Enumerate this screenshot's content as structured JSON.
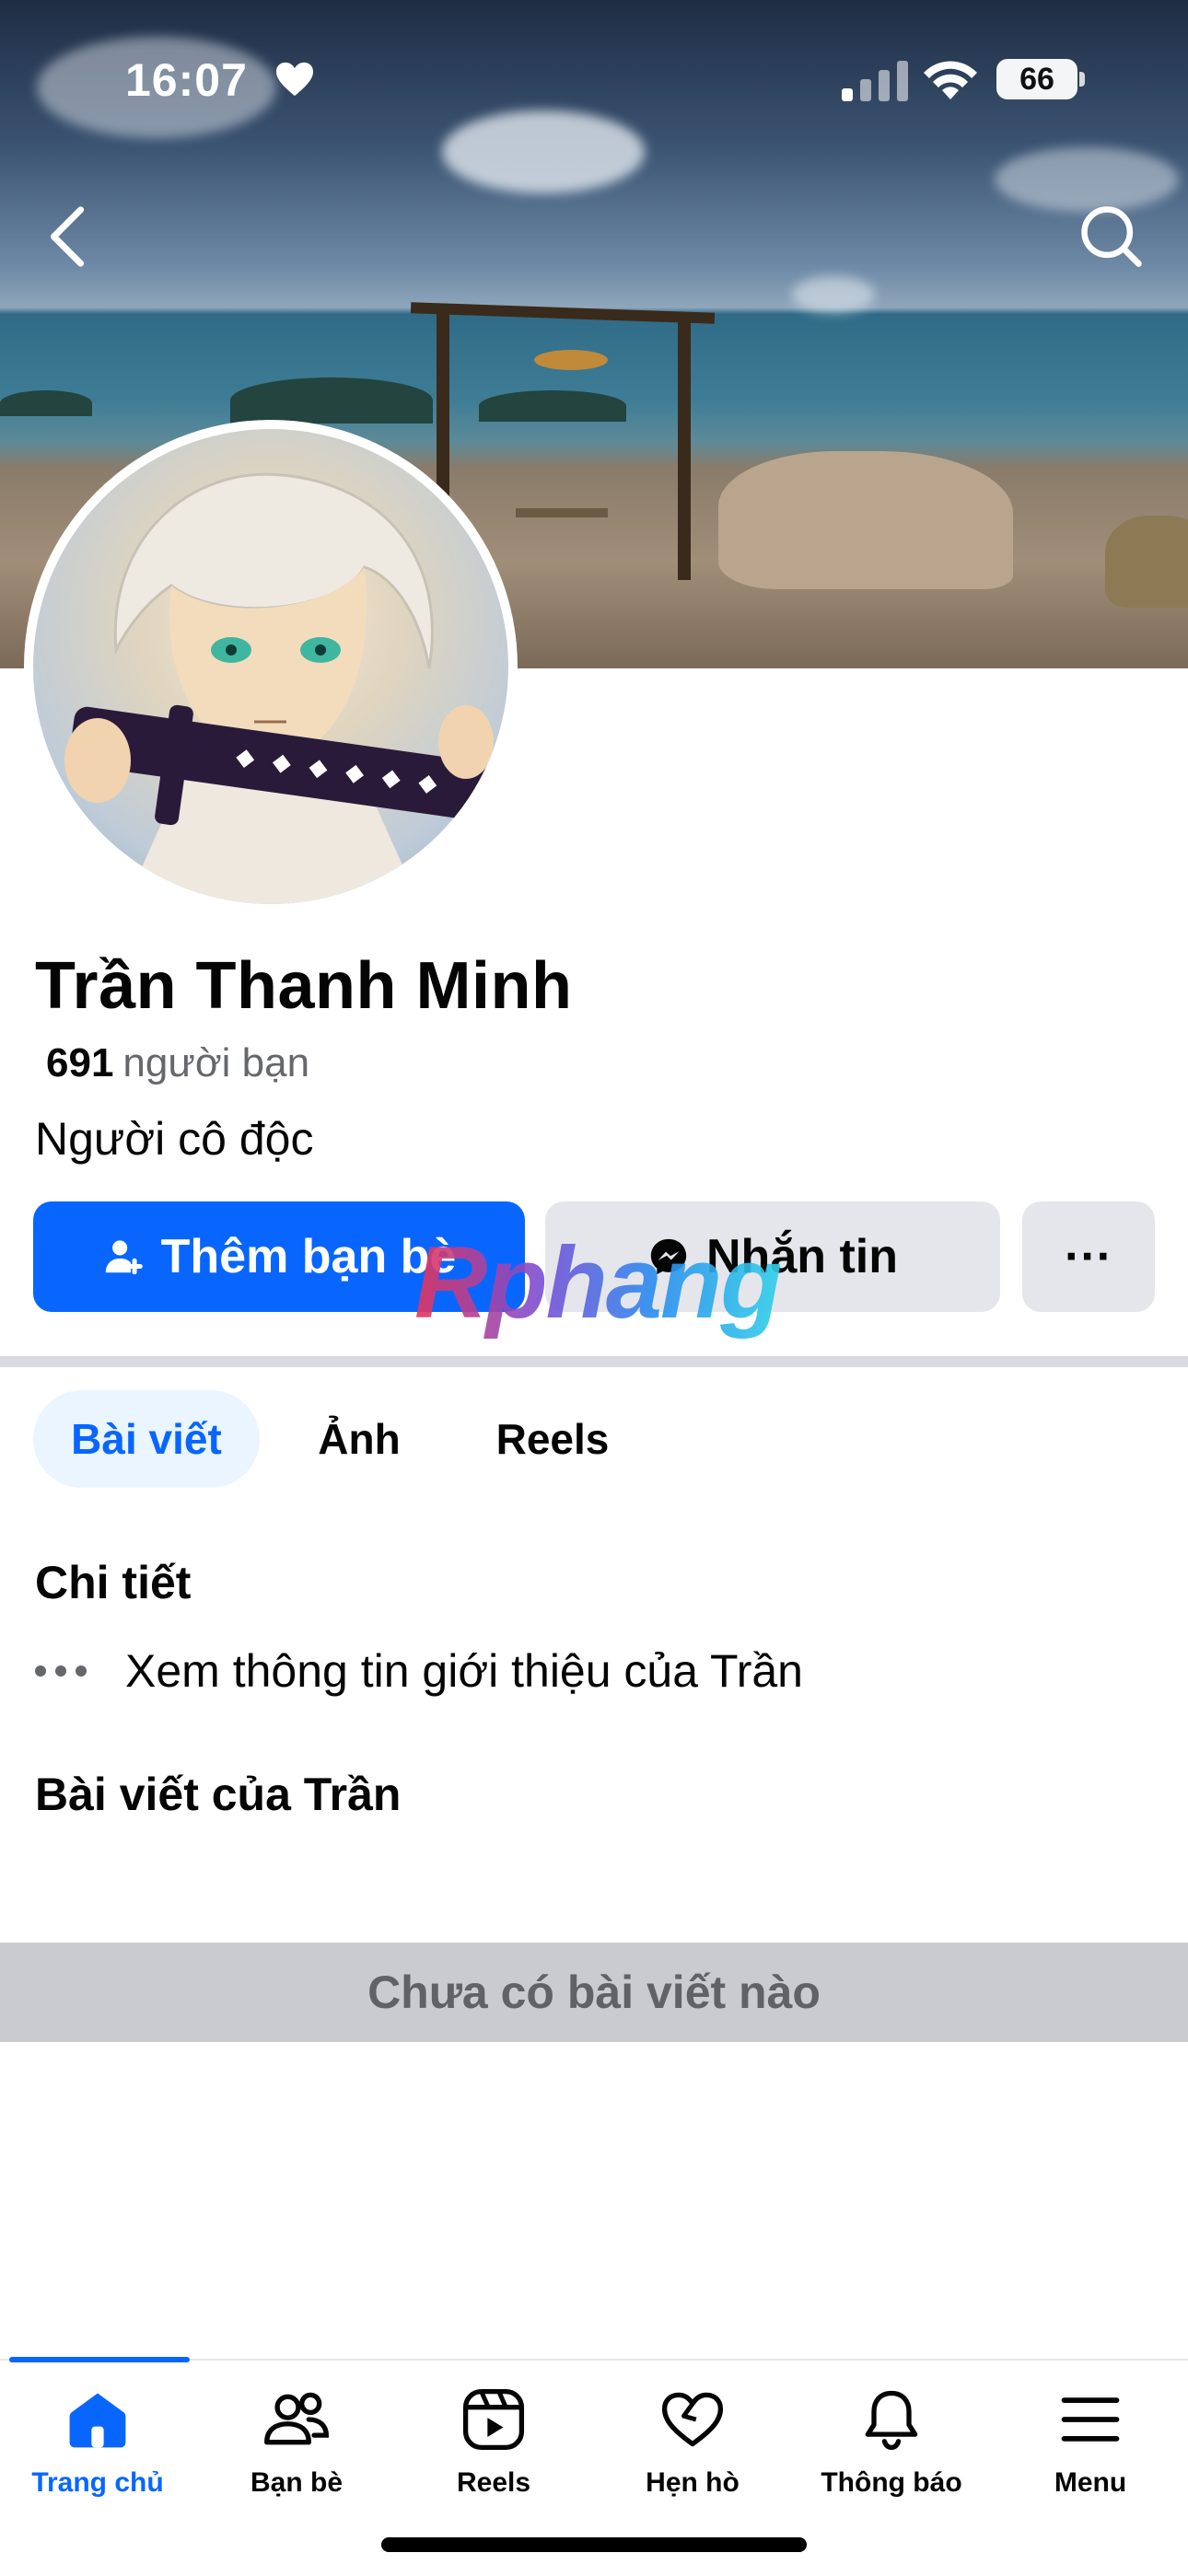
{
  "status_bar": {
    "time": "16:07",
    "battery": "66",
    "icons": [
      "heart-icon",
      "signal-icon",
      "wifi-icon",
      "battery-icon"
    ]
  },
  "header": {
    "icons": [
      "back-chevron-icon",
      "search-icon"
    ]
  },
  "profile": {
    "name": "Trần Thanh Minh",
    "friends_count": "691",
    "friends_label": "người bạn",
    "bio": "Người cô độc"
  },
  "actions": {
    "add_friend": "Thêm bạn bè",
    "message": "Nhắn tin",
    "more": "···"
  },
  "watermark": "Rphang",
  "tabs": [
    {
      "label": "Bài viết",
      "active": true
    },
    {
      "label": "Ảnh",
      "active": false
    },
    {
      "label": "Reels",
      "active": false
    }
  ],
  "details": {
    "title": "Chi tiết",
    "see_intro": "Xem thông tin giới thiệu của Trần"
  },
  "posts": {
    "title": "Bài viết của Trần",
    "empty": "Chưa có bài viết nào"
  },
  "bottom_nav": [
    {
      "label": "Trang chủ",
      "icon": "home-icon",
      "active": true
    },
    {
      "label": "Bạn bè",
      "icon": "friends-icon",
      "active": false
    },
    {
      "label": "Reels",
      "icon": "reels-icon",
      "active": false
    },
    {
      "label": "Hẹn hò",
      "icon": "dating-heart-icon",
      "active": false
    },
    {
      "label": "Thông báo",
      "icon": "bell-icon",
      "active": false
    },
    {
      "label": "Menu",
      "icon": "menu-icon",
      "active": false
    }
  ],
  "colors": {
    "accent": "#0866ff",
    "button_gray": "#e4e6eb",
    "tab_active_bg": "#ebf5ff",
    "secondary_text": "#65676b"
  }
}
